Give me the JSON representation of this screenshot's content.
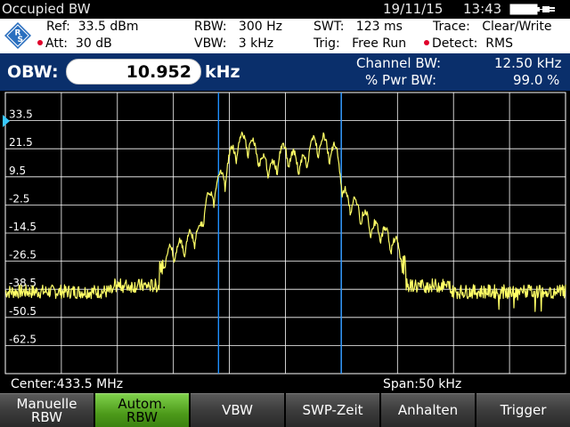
{
  "titlebar": {
    "title": "Occupied BW",
    "date": "19/11/15",
    "time": "13:43",
    "battery_icon": "battery-plug-icon"
  },
  "settings": {
    "ref": "Ref:  33.5 dBm",
    "att": "Att:  30 dB",
    "rbw": "RBW:   300 Hz",
    "vbw": "VBW:   3 kHz",
    "swt": "SWT:   123 ms",
    "trig": "Trig:   Free Run",
    "trace": "Trace:   Clear/Write",
    "detect": "Detect:  RMS",
    "marker_color": "#e0002a"
  },
  "measurement": {
    "obw_label": "OBW:",
    "obw_value": "10.952",
    "obw_unit": "kHz",
    "channel_bw_label": "Channel BW:",
    "channel_bw_value": "12.50 kHz",
    "pwr_bw_label": "% Pwr BW:",
    "pwr_bw_value": "99.0 %"
  },
  "chart_data": {
    "type": "line",
    "y_ticks": [
      "33.5",
      "21.5",
      "9.5",
      "-2.5",
      "-14.5",
      "-26.5",
      "-38.5",
      "-50.5",
      "-62.5"
    ],
    "y_tick_values": [
      33.5,
      21.5,
      9.5,
      -2.5,
      -14.5,
      -26.5,
      -38.5,
      -50.5,
      -62.5
    ],
    "ylim": [
      -74.5,
      45.5
    ],
    "grid": true,
    "x_span_khz": 50,
    "x_center_mhz": 433.5,
    "obw_limits_fraction": [
      0.3805,
      0.5995
    ],
    "trace_color": "#ffff66",
    "grid_color": "#ffffff",
    "limit_color": "#1e90ff"
  },
  "footer": {
    "center": "Center:433.5 MHz",
    "span": "Span:50 kHz"
  },
  "softkeys": [
    {
      "label": "Manuelle\nRBW",
      "active": false
    },
    {
      "label": "Autom.\nRBW",
      "active": true
    },
    {
      "label": "VBW",
      "active": false
    },
    {
      "label": "SWP-Zeit",
      "active": false
    },
    {
      "label": "Anhalten",
      "active": false
    },
    {
      "label": "Trigger",
      "active": false
    }
  ]
}
